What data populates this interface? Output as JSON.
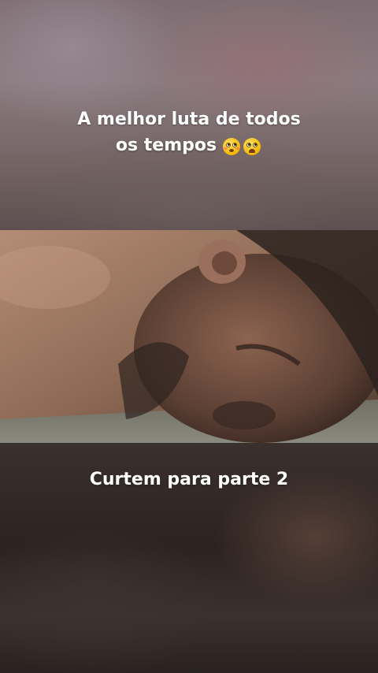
{
  "top_caption": {
    "line1": "A melhor luta de todos",
    "line2": "os tempos",
    "emojis": [
      "flushed-face-icon",
      "worried-face-icon"
    ]
  },
  "bottom_caption": {
    "text": "Curtem para parte 2"
  },
  "colors": {
    "caption_text": "#ffffff",
    "bg_top": "#7d6d72",
    "bg_bottom": "#2c2321"
  }
}
